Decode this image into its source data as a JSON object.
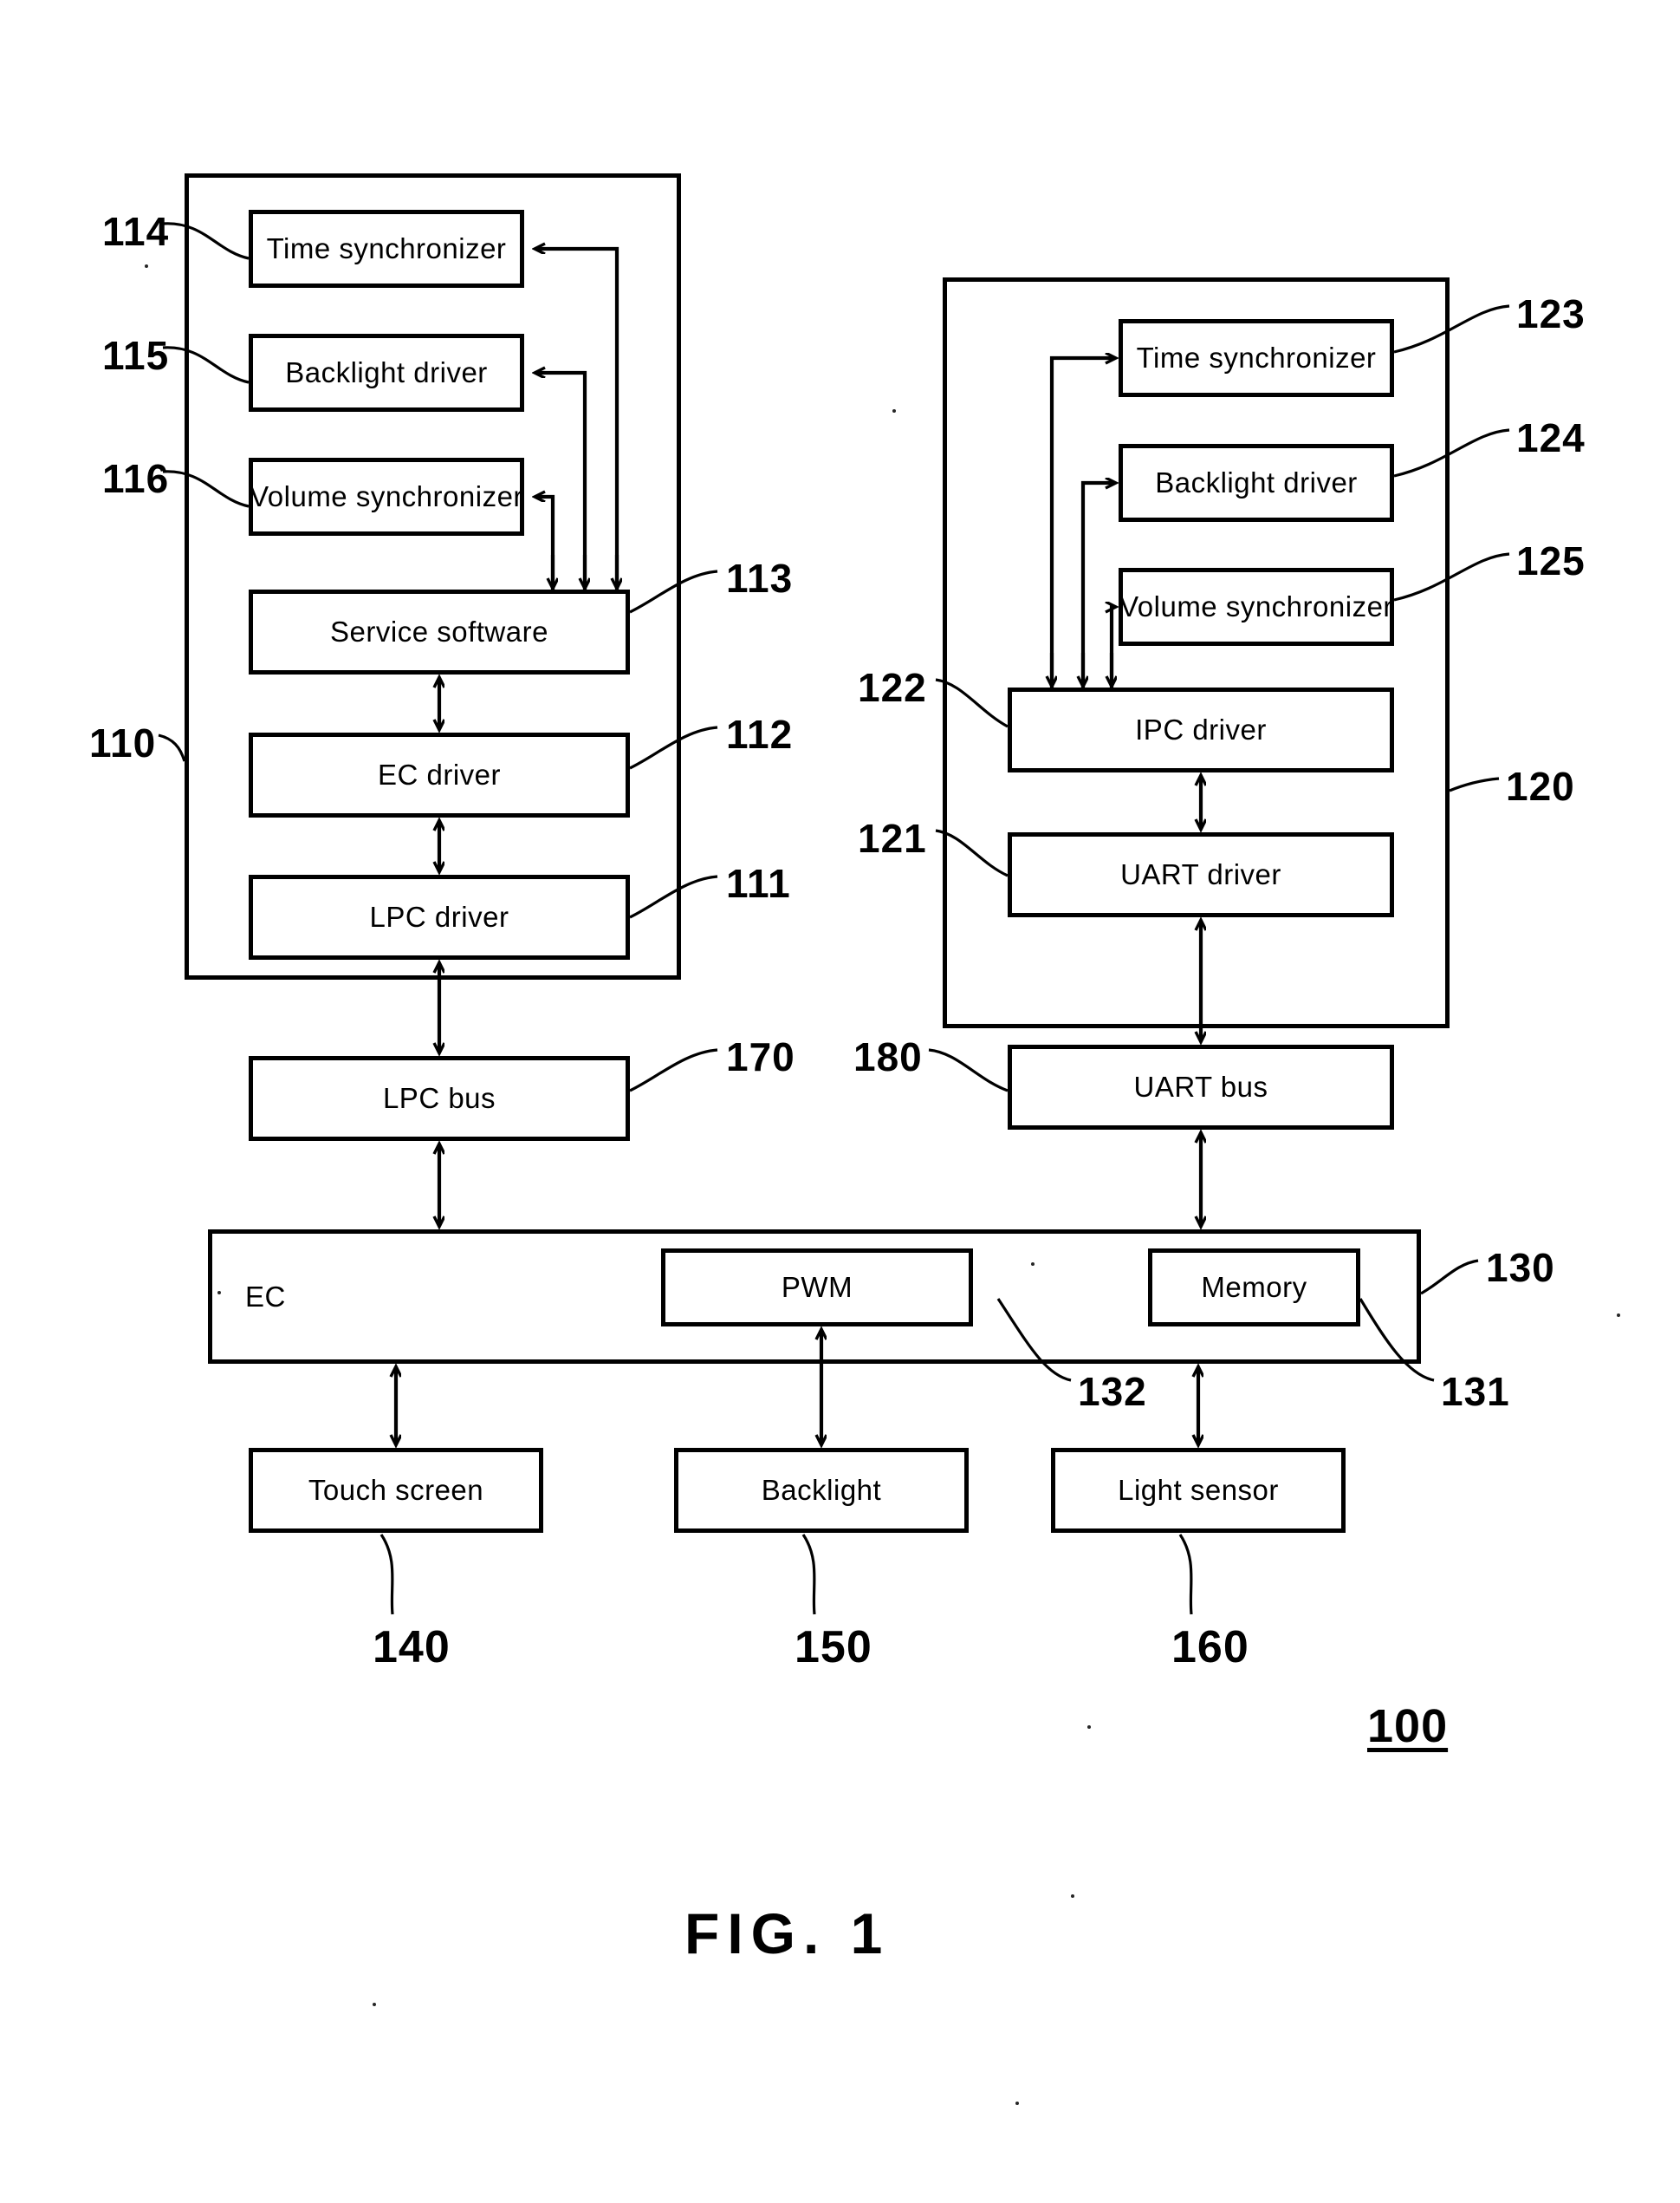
{
  "figure": {
    "caption": "FIG. 1",
    "system_ref": "100"
  },
  "groups": {
    "left": {
      "ref": "110"
    },
    "right": {
      "ref": "120"
    }
  },
  "left_stack": {
    "time_synchronizer": {
      "label": "Time synchronizer",
      "ref": "114"
    },
    "backlight_driver": {
      "label": "Backlight driver",
      "ref": "115"
    },
    "volume_synchronizer": {
      "label": "Volume synchronizer",
      "ref": "116"
    },
    "service_software": {
      "label": "Service software",
      "ref": "113"
    },
    "ec_driver": {
      "label": "EC driver",
      "ref": "112"
    },
    "lpc_driver": {
      "label": "LPC driver",
      "ref": "111"
    }
  },
  "right_stack": {
    "time_synchronizer": {
      "label": "Time synchronizer",
      "ref": "123"
    },
    "backlight_driver": {
      "label": "Backlight driver",
      "ref": "124"
    },
    "volume_synchronizer": {
      "label": "Volume synchronizer",
      "ref": "125"
    },
    "ipc_driver": {
      "label": "IPC driver",
      "ref": "122"
    },
    "uart_driver": {
      "label": "UART driver",
      "ref": "121"
    }
  },
  "buses": {
    "lpc_bus": {
      "label": "LPC bus",
      "ref": "170"
    },
    "uart_bus": {
      "label": "UART bus",
      "ref": "180"
    }
  },
  "controller": {
    "label": "EC",
    "ref": "130",
    "pwm": {
      "label": "PWM",
      "ref": "132"
    },
    "memory": {
      "label": "Memory",
      "ref": "131"
    }
  },
  "peripherals": [
    {
      "label": "Touch screen",
      "ref": "140"
    },
    {
      "label": "Backlight",
      "ref": "150"
    },
    {
      "label": "Light sensor",
      "ref": "160"
    }
  ],
  "colors": {
    "ink": "#000000",
    "paper": "#ffffff"
  }
}
